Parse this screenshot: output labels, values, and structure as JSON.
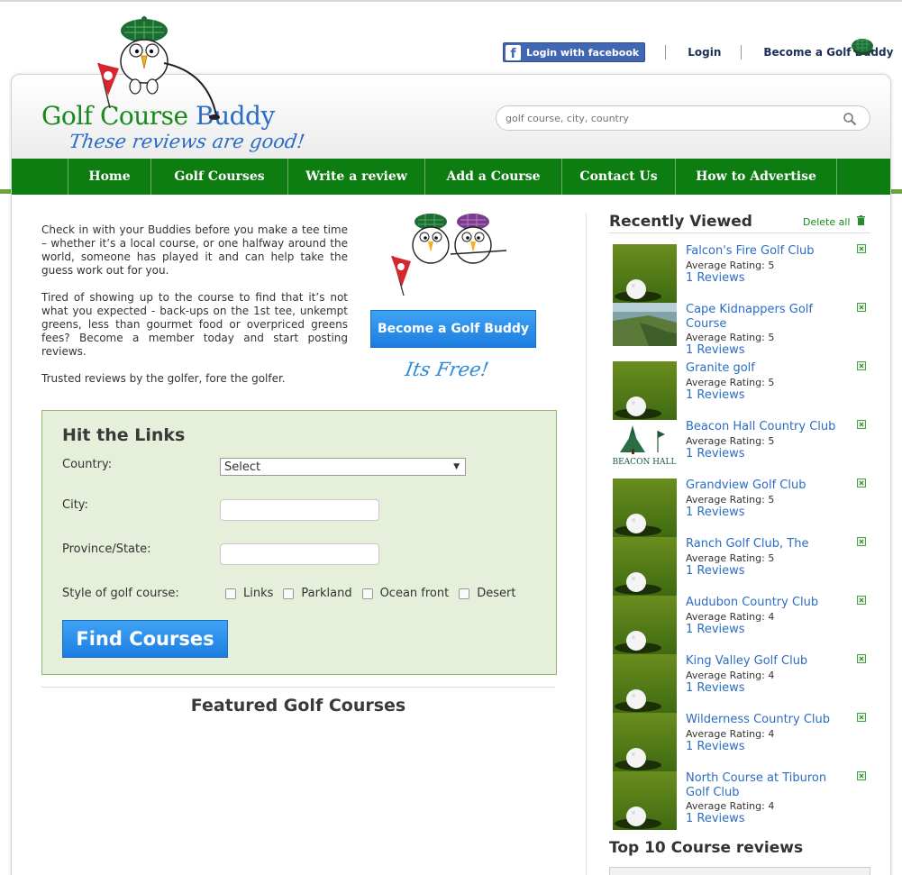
{
  "topbar": {
    "facebook_label": "Login with facebook",
    "login_label": "Login",
    "become_label": "Become a Golf Buddy"
  },
  "logo": {
    "part1": "Golf Course",
    "part2": "Buddy",
    "tagline": "These reviews are good!"
  },
  "search": {
    "placeholder": "golf course, city, country"
  },
  "nav": {
    "items": [
      "Home",
      "Golf Courses",
      "Write a review",
      "Add a Course",
      "Contact Us",
      "How to Advertise"
    ]
  },
  "intro": {
    "p1": "Check in with your Buddies before you make a tee time – whether it’s a local course, or one halfway around the world, someone has played it and can help take the guess work out for you.",
    "p2": "Tired of showing up to the course to find that it’s not what you expected - back-ups on the 1st tee, unkempt greens, less than gourmet food or overpriced greens fees? Become a member today and start posting reviews.",
    "p3": "Trusted reviews by the golfer, fore the golfer.",
    "become_button": "Become a Golf Buddy",
    "free_text": "Its Free!"
  },
  "search_form": {
    "title": "Hit the Links",
    "country_label": "Country:",
    "country_value": "Select",
    "city_label": "City:",
    "city_value": "",
    "province_label": "Province/State:",
    "province_value": "",
    "style_label": "Style of golf course:",
    "styles": [
      "Links",
      "Parkland",
      "Ocean front",
      "Desert"
    ],
    "find_button": "Find Courses"
  },
  "featured": {
    "title": "Featured Golf Courses"
  },
  "recently_viewed": {
    "title": "Recently Viewed",
    "delete_all": "Delete all",
    "rating_prefix": "Average Rating:",
    "items": [
      {
        "name": "Falcon's Fire Golf Club",
        "rating": "Average Rating: 5",
        "reviews": "1 Reviews",
        "thumb": "golf-ball"
      },
      {
        "name": "Cape Kidnappers Golf Course",
        "rating": "Average Rating: 5",
        "reviews": "1 Reviews",
        "thumb": "coastline"
      },
      {
        "name": "Granite golf",
        "rating": "Average Rating: 5",
        "reviews": "1 Reviews",
        "thumb": "golf-ball"
      },
      {
        "name": "Beacon Hall Country Club",
        "rating": "Average Rating: 5",
        "reviews": "1 Reviews",
        "thumb": "beacon-hall-logo",
        "logo_text": "BEACON HALL"
      },
      {
        "name": "Grandview Golf Club",
        "rating": "Average Rating: 5",
        "reviews": "1 Reviews",
        "thumb": "golf-ball"
      },
      {
        "name": "Ranch Golf Club, The",
        "rating": "Average Rating: 5",
        "reviews": "1 Reviews",
        "thumb": "golf-ball"
      },
      {
        "name": "Audubon Country Club",
        "rating": "Average Rating: 4",
        "reviews": "1 Reviews",
        "thumb": "golf-ball"
      },
      {
        "name": "King Valley Golf Club",
        "rating": "Average Rating: 4",
        "reviews": "1 Reviews",
        "thumb": "golf-ball"
      },
      {
        "name": "Wilderness Country Club",
        "rating": "Average Rating: 4",
        "reviews": "1 Reviews",
        "thumb": "golf-ball"
      },
      {
        "name": "North Course at Tiburon Golf Club",
        "rating": "Average Rating: 4",
        "reviews": "1 Reviews",
        "thumb": "golf-ball"
      }
    ]
  },
  "top10": {
    "title": "Top 10 Course reviews"
  },
  "colors": {
    "nav_green": "#0d7c11",
    "logo_green": "#168a1a",
    "link_blue": "#2b6cc4",
    "button_blue": "#1c7de0",
    "form_bg": "#e5efd9"
  }
}
